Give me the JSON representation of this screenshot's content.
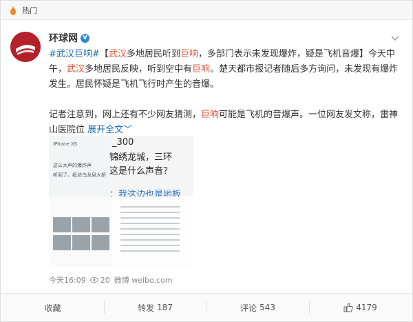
{
  "topbar": {
    "label": "热门"
  },
  "account": {
    "name": "环球网",
    "verified_mark": "V"
  },
  "post": {
    "p1": [
      {
        "text": "#武汉巨响#",
        "style": "link"
      },
      {
        "text": "【",
        "style": "plain"
      },
      {
        "text": "武汉",
        "style": "red"
      },
      {
        "text": "多地居民听到",
        "style": "plain"
      },
      {
        "text": "巨响",
        "style": "red"
      },
      {
        "text": "，多部门表示未发现爆炸，疑是飞机音爆】今天中午，",
        "style": "plain"
      },
      {
        "text": "武汉",
        "style": "red"
      },
      {
        "text": "多地居民反映，听到空中有",
        "style": "plain"
      },
      {
        "text": "巨响",
        "style": "red"
      },
      {
        "text": "。楚天都市报记者随后多方询问，未发现有爆炸发生。居民怀疑是飞机飞行时产生的音爆。",
        "style": "plain"
      }
    ],
    "p2": [
      {
        "text": "记者注意到，网上还有不少网友猜测，",
        "style": "plain"
      },
      {
        "text": "巨响",
        "style": "red"
      },
      {
        "text": "可能是飞机的音爆声。一位网友发文称，雷神山医院位 ",
        "style": "plain"
      },
      {
        "text": "展开全文﹀",
        "style": "link"
      }
    ]
  },
  "images": {
    "ib1_rows": [
      "iPhone XS",
      "这么大声的爆炸声",
      "听到了。纸坊乌龙泉大桥"
    ],
    "ib2_lines": [
      "_300",
      "锦绣龙城，三环",
      "这是什么声音？",
      "：我这边也是地板"
    ]
  },
  "meta": {
    "time": "今天16:09",
    "views": "20",
    "source": "微博 weibo.com"
  },
  "actions": [
    {
      "label": "收藏",
      "count": ""
    },
    {
      "label": "转发",
      "count": "187"
    },
    {
      "label": "评论",
      "count": "543"
    },
    {
      "label": "",
      "count": "4179"
    }
  ],
  "colors": {
    "accent_red": "#e0533b",
    "link_blue": "#1c6bb0",
    "avatar_red": "#b3212b"
  }
}
